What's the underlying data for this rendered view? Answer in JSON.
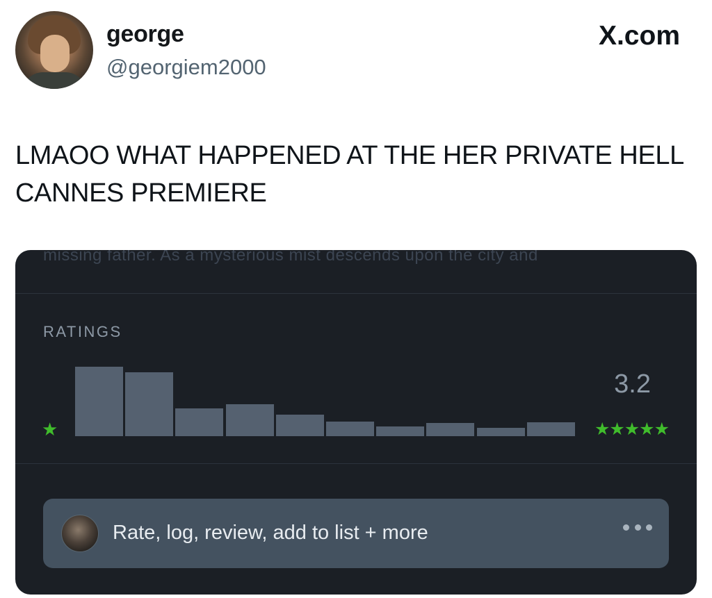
{
  "tweet": {
    "author_name": "george",
    "author_handle": "@georgiem2000",
    "site_label": "X.com",
    "text": "LMAOO WHAT HAPPENED AT THE HER PRIVATE HELL CANNES PREMIERE"
  },
  "card": {
    "cut_off_text": "missing father. As a mysterious mist descends upon the city and",
    "ratings_label": "RATINGS",
    "average_rating": "3.2",
    "min_star": "★",
    "max_stars": "★★★★★",
    "histogram": {
      "bins": [
        "0.5",
        "1",
        "1.5",
        "2",
        "2.5",
        "3",
        "3.5",
        "4",
        "4.5",
        "5"
      ],
      "relative_heights": [
        1.0,
        0.92,
        0.4,
        0.46,
        0.31,
        0.21,
        0.14,
        0.19,
        0.12,
        0.2
      ]
    },
    "action_text": "Rate, log, review, add to list + more",
    "more_icon": "more-dots-icon"
  },
  "colors": {
    "card_background": "#1b1f25",
    "bar_color": "#556170",
    "star_green": "#40bc2c",
    "action_bar": "#445260"
  }
}
